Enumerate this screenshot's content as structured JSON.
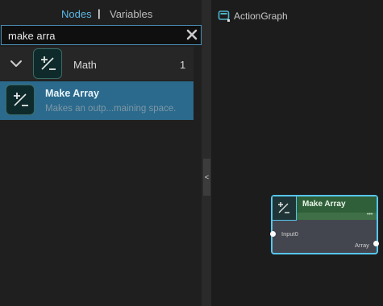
{
  "tabs": {
    "nodes_label": "Nodes",
    "separator": "|",
    "variables_label": "Variables"
  },
  "search": {
    "value": "make arra",
    "clear_icon": "close-icon"
  },
  "category": {
    "label": "Math",
    "count": "1",
    "icon": "plus-minus-icon"
  },
  "result": {
    "title": "Make Array",
    "description": "Makes an outp...maining space.",
    "icon": "plus-minus-icon"
  },
  "splitter": {
    "collapse_glyph": "<"
  },
  "graph": {
    "title": "ActionGraph",
    "icon": "graph-icon"
  },
  "node": {
    "title": "Make Array",
    "menu_glyph": "•••",
    "input_label": "Input0",
    "output_label": "Array",
    "icon": "plus-minus-icon"
  },
  "colors": {
    "accent": "#5bb7e6",
    "selected_row": "#2b6a8c",
    "node_header": "#2f5f38",
    "node_border": "#57c6ee"
  }
}
